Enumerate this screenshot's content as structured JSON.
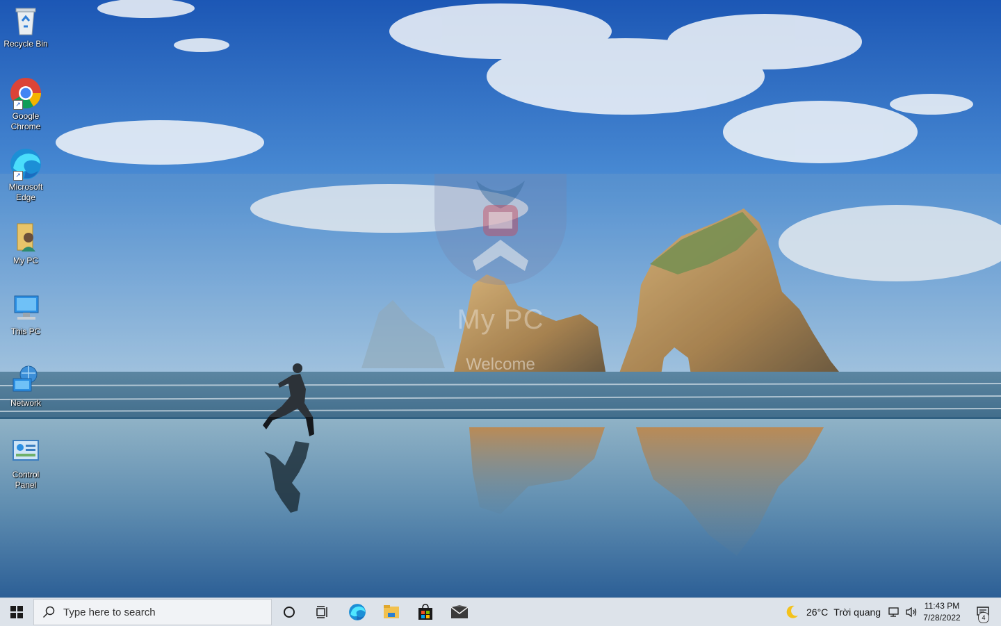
{
  "desktop": {
    "icons": [
      {
        "label": "Recycle Bin",
        "icon": "recycle-bin-icon"
      },
      {
        "label": "Google Chrome",
        "icon": "chrome-icon"
      },
      {
        "label": "Microsoft Edge",
        "icon": "edge-icon"
      },
      {
        "label": "My PC",
        "icon": "user-folder-icon"
      },
      {
        "label": "This PC",
        "icon": "computer-icon"
      },
      {
        "label": "Network",
        "icon": "network-icon"
      },
      {
        "label": "Control Panel",
        "icon": "control-panel-icon"
      }
    ]
  },
  "overlay": {
    "username": "My PC",
    "welcome": "Welcome"
  },
  "taskbar": {
    "search_placeholder": "Type here to search",
    "apps": [
      "cortana-icon",
      "task-view-icon",
      "edge-icon",
      "file-explorer-icon",
      "store-icon",
      "mail-icon"
    ],
    "weather": {
      "temp": "26°C",
      "condition": "Trời quang",
      "icon": "moon-icon"
    },
    "clock": {
      "time": "11:43 PM",
      "date": "7/28/2022"
    },
    "notification_count": "4"
  },
  "colors": {
    "taskbar_bg": "#dde3ea",
    "sky_top": "#1f5fb8",
    "sea": "#3f7596"
  }
}
